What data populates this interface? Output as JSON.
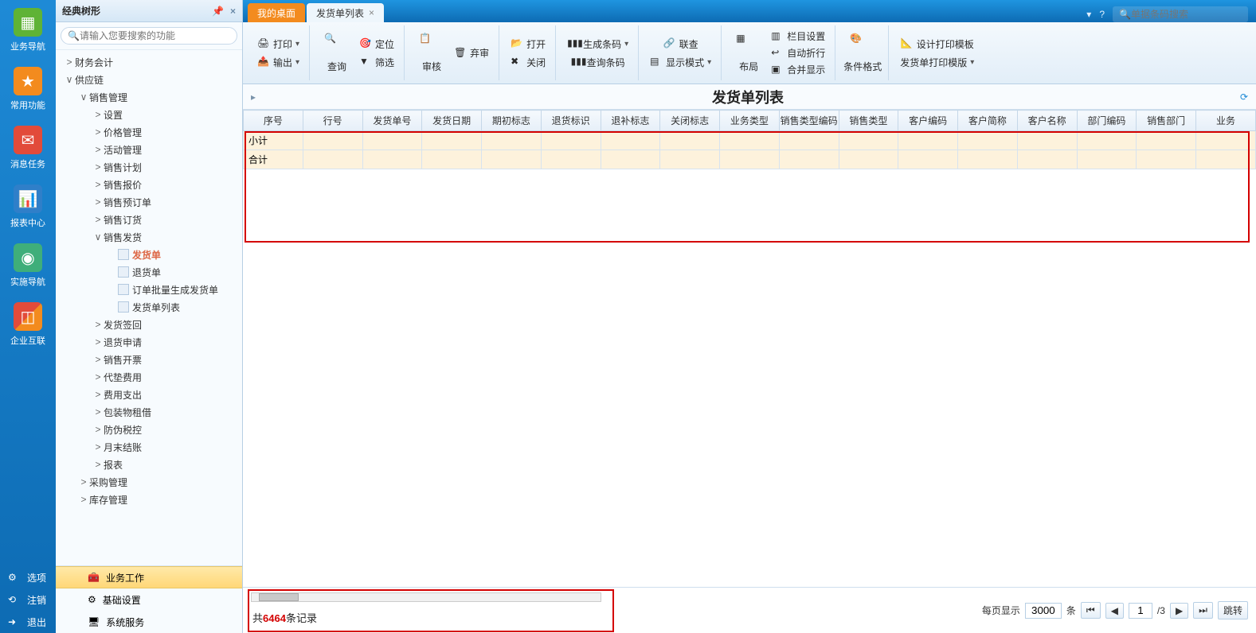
{
  "leftrail": {
    "items": [
      {
        "label": "业务导航",
        "icon": "nav-icon",
        "color": "ic-green"
      },
      {
        "label": "常用功能",
        "icon": "star-icon",
        "color": "ic-orange"
      },
      {
        "label": "消息任务",
        "icon": "mail-icon",
        "color": "ic-red"
      },
      {
        "label": "报表中心",
        "icon": "report-icon",
        "color": "ic-blue"
      },
      {
        "label": "实施导航",
        "icon": "compass-icon",
        "color": "ic-teal"
      },
      {
        "label": "企业互联",
        "icon": "connect-icon",
        "color": "ic-mix"
      }
    ],
    "bottom": [
      {
        "label": "选项",
        "icon": "gear-icon"
      },
      {
        "label": "注销",
        "icon": "logout-icon"
      },
      {
        "label": "退出",
        "icon": "exit-icon"
      }
    ]
  },
  "treepanel": {
    "title": "经典树形",
    "search_placeholder": "请输入您要搜索的功能",
    "footer": [
      {
        "label": "业务工作",
        "active": true
      },
      {
        "label": "基础设置",
        "active": false
      },
      {
        "label": "系统服务",
        "active": false
      }
    ],
    "nodes": [
      {
        "indent": 0,
        "tw": ">",
        "label": "财务会计"
      },
      {
        "indent": 0,
        "tw": "∨",
        "label": "供应链"
      },
      {
        "indent": 1,
        "tw": "∨",
        "label": "销售管理"
      },
      {
        "indent": 2,
        "tw": ">",
        "label": "设置"
      },
      {
        "indent": 2,
        "tw": ">",
        "label": "价格管理"
      },
      {
        "indent": 2,
        "tw": ">",
        "label": "活动管理"
      },
      {
        "indent": 2,
        "tw": ">",
        "label": "销售计划"
      },
      {
        "indent": 2,
        "tw": ">",
        "label": "销售报价"
      },
      {
        "indent": 2,
        "tw": ">",
        "label": "销售预订单"
      },
      {
        "indent": 2,
        "tw": ">",
        "label": "销售订货"
      },
      {
        "indent": 2,
        "tw": "∨",
        "label": "销售发货"
      },
      {
        "indent": 3,
        "tw": "",
        "label": "发货单",
        "doc": true,
        "active": true
      },
      {
        "indent": 3,
        "tw": "",
        "label": "退货单",
        "doc": true
      },
      {
        "indent": 3,
        "tw": "",
        "label": "订单批量生成发货单",
        "doc": true
      },
      {
        "indent": 3,
        "tw": "",
        "label": "发货单列表",
        "doc": true
      },
      {
        "indent": 2,
        "tw": ">",
        "label": "发货签回"
      },
      {
        "indent": 2,
        "tw": ">",
        "label": "退货申请"
      },
      {
        "indent": 2,
        "tw": ">",
        "label": "销售开票"
      },
      {
        "indent": 2,
        "tw": ">",
        "label": "代垫费用"
      },
      {
        "indent": 2,
        "tw": ">",
        "label": "费用支出"
      },
      {
        "indent": 2,
        "tw": ">",
        "label": "包装物租借"
      },
      {
        "indent": 2,
        "tw": ">",
        "label": "防伪税控"
      },
      {
        "indent": 2,
        "tw": ">",
        "label": "月末结账"
      },
      {
        "indent": 2,
        "tw": ">",
        "label": "报表"
      },
      {
        "indent": 1,
        "tw": ">",
        "label": "采购管理"
      },
      {
        "indent": 1,
        "tw": ">",
        "label": "库存管理"
      }
    ]
  },
  "tabs": [
    {
      "label": "我的桌面",
      "home": true
    },
    {
      "label": "发货单列表",
      "active": true,
      "closable": true
    }
  ],
  "top_search_placeholder": "单据条码搜索",
  "ribbon": {
    "print": "打印",
    "export": "输出",
    "query": "查询",
    "locate": "定位",
    "filter": "筛选",
    "audit": "审核",
    "discard": "弃审",
    "open": "打开",
    "close": "关闭",
    "gencode": "生成条码",
    "querycode": "查询条码",
    "related": "联查",
    "dispmode": "显示模式",
    "layout": "布局",
    "colset": "栏目设置",
    "autowrap": "自动折行",
    "mergeshow": "合并显示",
    "condfmt": "条件格式",
    "designtpl": "设计打印模板",
    "printtpl": "发货单打印模版"
  },
  "page_title": "发货单列表",
  "columns": [
    "序号",
    "行号",
    "发货单号",
    "发货日期",
    "期初标志",
    "退货标识",
    "退补标志",
    "关闭标志",
    "业务类型",
    "销售类型编码",
    "销售类型",
    "客户编码",
    "客户简称",
    "客户名称",
    "部门编码",
    "销售部门",
    "业务"
  ],
  "rows": {
    "subtotal": "小计",
    "total": "合计"
  },
  "footer": {
    "rec_prefix": "共",
    "rec_count": "6464",
    "rec_suffix": "条记录",
    "perpage_label": "每页显示",
    "perpage_value": "3000",
    "perpage_unit": "条",
    "page_value": "1",
    "page_total": "/3",
    "jump": "跳转"
  }
}
